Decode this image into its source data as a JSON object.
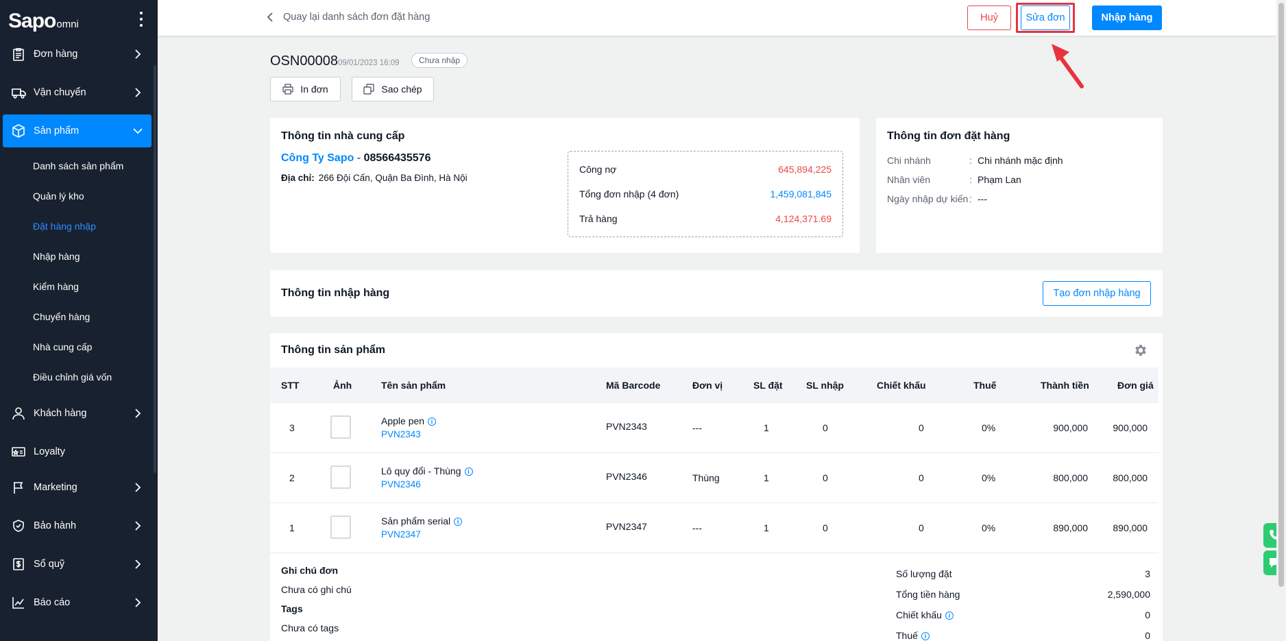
{
  "sidebar": {
    "logo_brand": "Sapo",
    "logo_sub": "omni",
    "items": [
      {
        "label": "Đơn hàng",
        "icon": "clipboard-icon"
      },
      {
        "label": "Vận chuyển",
        "icon": "truck-icon"
      },
      {
        "label": "Sản phẩm",
        "icon": "box-icon"
      },
      {
        "label": "Khách hàng",
        "icon": "user-icon"
      },
      {
        "label": "Loyalty",
        "icon": "card-icon"
      },
      {
        "label": "Marketing",
        "icon": "flag-icon"
      },
      {
        "label": "Bảo hành",
        "icon": "shield-icon"
      },
      {
        "label": "Sổ quỹ",
        "icon": "cashbook-icon"
      },
      {
        "label": "Báo cáo",
        "icon": "chart-icon"
      }
    ],
    "sub_items": [
      "Danh sách sản phẩm",
      "Quản lý kho",
      "Đặt hàng nhập",
      "Nhập hàng",
      "Kiểm hàng",
      "Chuyển hàng",
      "Nhà cung cấp",
      "Điều chỉnh giá vốn"
    ]
  },
  "topbar": {
    "back_label": "Quay lại danh sách đơn đặt hàng",
    "cancel_label": "Huỷ",
    "edit_label": "Sửa đơn",
    "import_label": "Nhập hàng"
  },
  "order": {
    "code": "OSN00008",
    "date": "09/01/2023 16:09",
    "status": "Chưa nhập",
    "print_label": "In đơn",
    "copy_label": "Sao chép"
  },
  "supplier": {
    "title": "Thông tin nhà cung cấp",
    "name": "Công Ty Sapo",
    "separator": " - ",
    "phone": "08566435576",
    "address_label": "Địa chỉ:",
    "address": "266 Đội Cấn, Quận Ba Đình, Hà Nội",
    "debt": [
      {
        "label": "Công nợ",
        "value": "645,894,225"
      },
      {
        "label": "Tổng đơn nhập (4 đơn)",
        "value": "1,459,081,845"
      },
      {
        "label": "Trả hàng",
        "value": "4,124,371.69"
      }
    ]
  },
  "order_info": {
    "title": "Thông tin đơn đặt hàng",
    "rows": [
      {
        "label": "Chi nhánh",
        "value": "Chi nhánh mặc định"
      },
      {
        "label": "Nhân viên",
        "value": "Phạm Lan"
      },
      {
        "label": "Ngày nhập dự kiến",
        "value": "---"
      }
    ],
    "colon": ":"
  },
  "import_info": {
    "title": "Thông tin nhập hàng",
    "create_label": "Tạo đơn nhập hàng"
  },
  "products": {
    "title": "Thông tin sản phẩm",
    "columns": [
      "STT",
      "Ảnh",
      "Tên sản phẩm",
      "Mã Barcode",
      "Đơn vị",
      "SL đặt",
      "SL nhập",
      "Chiết khấu",
      "Thuế",
      "Thành tiền",
      "Đơn giá"
    ],
    "rows": [
      {
        "stt": "3",
        "name": "Apple pen",
        "sku": "PVN2343",
        "barcode": "PVN2343",
        "unit": "---",
        "qty": "1",
        "imported": "0",
        "discount": "0",
        "tax": "0%",
        "total": "900,000",
        "price": "900,000"
      },
      {
        "stt": "2",
        "name": "Lô quy đổi - Thùng",
        "sku": "PVN2346",
        "barcode": "PVN2346",
        "unit": "Thùng",
        "qty": "1",
        "imported": "0",
        "discount": "0",
        "tax": "0%",
        "total": "800,000",
        "price": "800,000"
      },
      {
        "stt": "1",
        "name": "Sản phẩm serial",
        "sku": "PVN2347",
        "barcode": "PVN2347",
        "unit": "---",
        "qty": "1",
        "imported": "0",
        "discount": "0",
        "tax": "0%",
        "total": "890,000",
        "price": "890,000"
      }
    ]
  },
  "footer": {
    "note_title": "Ghi chú đơn",
    "note_value": "Chưa có ghi chú",
    "tags_title": "Tags",
    "tags_value": "Chưa có tags",
    "summary": [
      {
        "label": "Số lượng đặt",
        "value": "3"
      },
      {
        "label": "Tổng tiền hàng",
        "value": "2,590,000"
      },
      {
        "label": "Chiết khấu",
        "value": "0"
      },
      {
        "label": "Thuế",
        "value": "0"
      }
    ]
  },
  "colors": {
    "primary": "#0088ff",
    "danger": "#ee4747",
    "sidebar_bg": "#18212f",
    "highlight": "#e8333e"
  }
}
